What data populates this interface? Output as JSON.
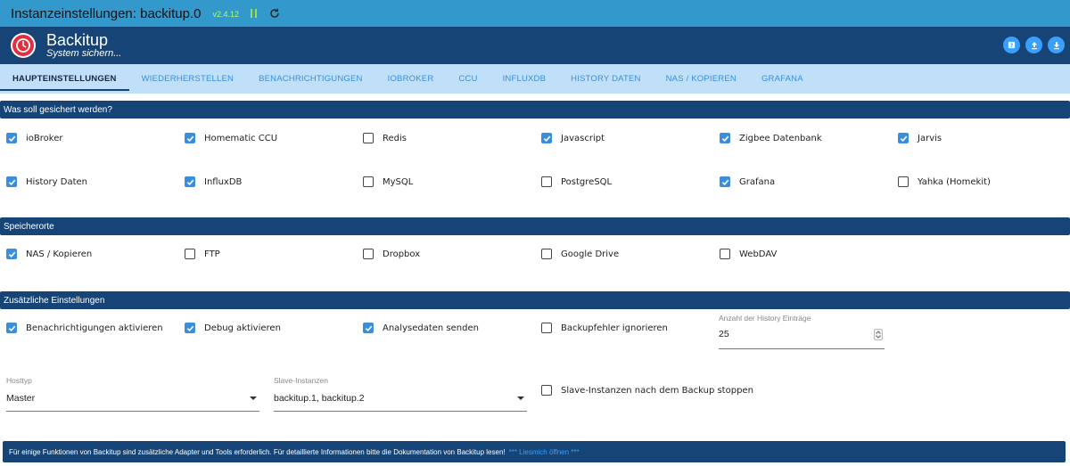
{
  "topbar": {
    "title": "Instanzeinstellungen: backitup.0",
    "version": "v2.4.12"
  },
  "header": {
    "name": "Backitup",
    "subtitle": "System sichern..."
  },
  "tabs": [
    "HAUPTEINSTELLUNGEN",
    "WIEDERHERSTELLEN",
    "BENACHRICHTIGUNGEN",
    "IOBROKER",
    "CCU",
    "INFLUXDB",
    "HISTORY DATEN",
    "NAS / KOPIEREN",
    "GRAFANA"
  ],
  "sections": {
    "backup": "Was soll gesichert werden?",
    "storage": "Speicherorte",
    "extra": "Zusätzliche Einstellungen"
  },
  "backup_items": [
    {
      "label": "ioBroker",
      "checked": true
    },
    {
      "label": "Homematic CCU",
      "checked": true
    },
    {
      "label": "Redis",
      "checked": false
    },
    {
      "label": "Javascript",
      "checked": true
    },
    {
      "label": "Zigbee Datenbank",
      "checked": true
    },
    {
      "label": "Jarvis",
      "checked": true
    },
    {
      "label": "History Daten",
      "checked": true
    },
    {
      "label": "InfluxDB",
      "checked": true
    },
    {
      "label": "MySQL",
      "checked": false
    },
    {
      "label": "PostgreSQL",
      "checked": false
    },
    {
      "label": "Grafana",
      "checked": true
    },
    {
      "label": "Yahka (Homekit)",
      "checked": false
    }
  ],
  "storage_items": [
    {
      "label": "NAS / Kopieren",
      "checked": true
    },
    {
      "label": "FTP",
      "checked": false
    },
    {
      "label": "Dropbox",
      "checked": false
    },
    {
      "label": "Google Drive",
      "checked": false
    },
    {
      "label": "WebDAV",
      "checked": false
    }
  ],
  "extra_items": [
    {
      "label": "Benachrichtigungen aktivieren",
      "checked": true
    },
    {
      "label": "Debug aktivieren",
      "checked": true
    },
    {
      "label": "Analysedaten senden",
      "checked": true
    },
    {
      "label": "Backupfehler ignorieren",
      "checked": false
    }
  ],
  "history_entries": {
    "label": "Anzahl der History Einträge",
    "value": "25"
  },
  "hosttyp": {
    "label": "Hosttyp",
    "value": "Master"
  },
  "slave": {
    "label": "Slave-Instanzen",
    "value": "backitup.1, backitup.2"
  },
  "slave_stop": {
    "label": "Slave-Instanzen nach dem Backup stoppen",
    "checked": false
  },
  "footer": {
    "text": "Für einige Funktionen von Backitup sind zusätzliche Adapter und Tools erforderlich. Für detaillierte Informationen bitte die Dokumentation von Backitup lesen!",
    "link": "*** Liesmich öffnen ***"
  },
  "colors": {
    "primary": "#164477",
    "accent": "#3a8ee0",
    "tabbar": "#bfe0f8",
    "topbar": "#3399cc"
  }
}
